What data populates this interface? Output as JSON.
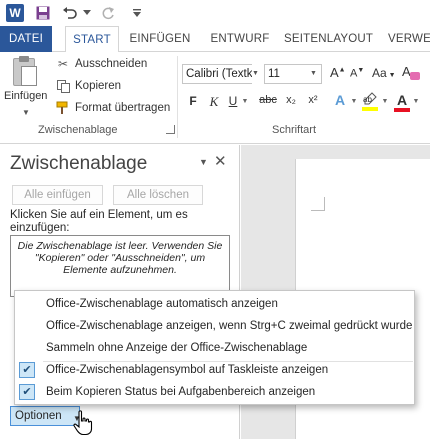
{
  "titlebar": {
    "app_icon_letter": "W"
  },
  "tabs": [
    {
      "label": "DATEI"
    },
    {
      "label": "START"
    },
    {
      "label": "EINFÜGEN"
    },
    {
      "label": "ENTWURF"
    },
    {
      "label": "SEITENLAYOUT"
    },
    {
      "label": "VERWE"
    }
  ],
  "ribbon": {
    "clipboard": {
      "paste_label": "Einfügen",
      "cut_label": "Ausschneiden",
      "copy_label": "Kopieren",
      "format_painter_label": "Format übertragen",
      "group_label": "Zwischenablage"
    },
    "font": {
      "font_name": "Calibri (Textk",
      "font_size": "11",
      "bold": "F",
      "italic": "K",
      "underline": "U",
      "strike": "abc",
      "subscript": "x₂",
      "superscript": "x²",
      "grow": "A",
      "shrink": "A",
      "case": "Aa",
      "group_label": "Schriftart",
      "highlight_color": "#ffff00",
      "font_color": "#e81123"
    }
  },
  "pane": {
    "title": "Zwischenablage",
    "paste_all": "Alle einfügen",
    "clear_all": "Alle löschen",
    "hint": "Klicken Sie auf ein Element, um es einzufügen:",
    "empty_message": "Die Zwischenablage ist leer. Verwenden Sie \"Kopieren\" oder \"Ausschneiden\", um Elemente aufzunehmen.",
    "options_label": "Optionen"
  },
  "options_menu": {
    "items": [
      {
        "label": "Office-Zwischenablage automatisch anzeigen",
        "checked": false
      },
      {
        "label": "Office-Zwischenablage anzeigen, wenn Strg+C zweimal gedrückt wurde",
        "checked": false
      },
      {
        "label": "Sammeln ohne Anzeige der Office-Zwischenablage",
        "checked": false
      },
      {
        "label": "Office-Zwischenablagensymbol auf Taskleiste anzeigen",
        "checked": true
      },
      {
        "label": "Beim Kopieren Status bei Aufgabenbereich anzeigen",
        "checked": true
      }
    ]
  },
  "colors": {
    "accent": "#2b579a",
    "selection": "#cde6f7"
  }
}
